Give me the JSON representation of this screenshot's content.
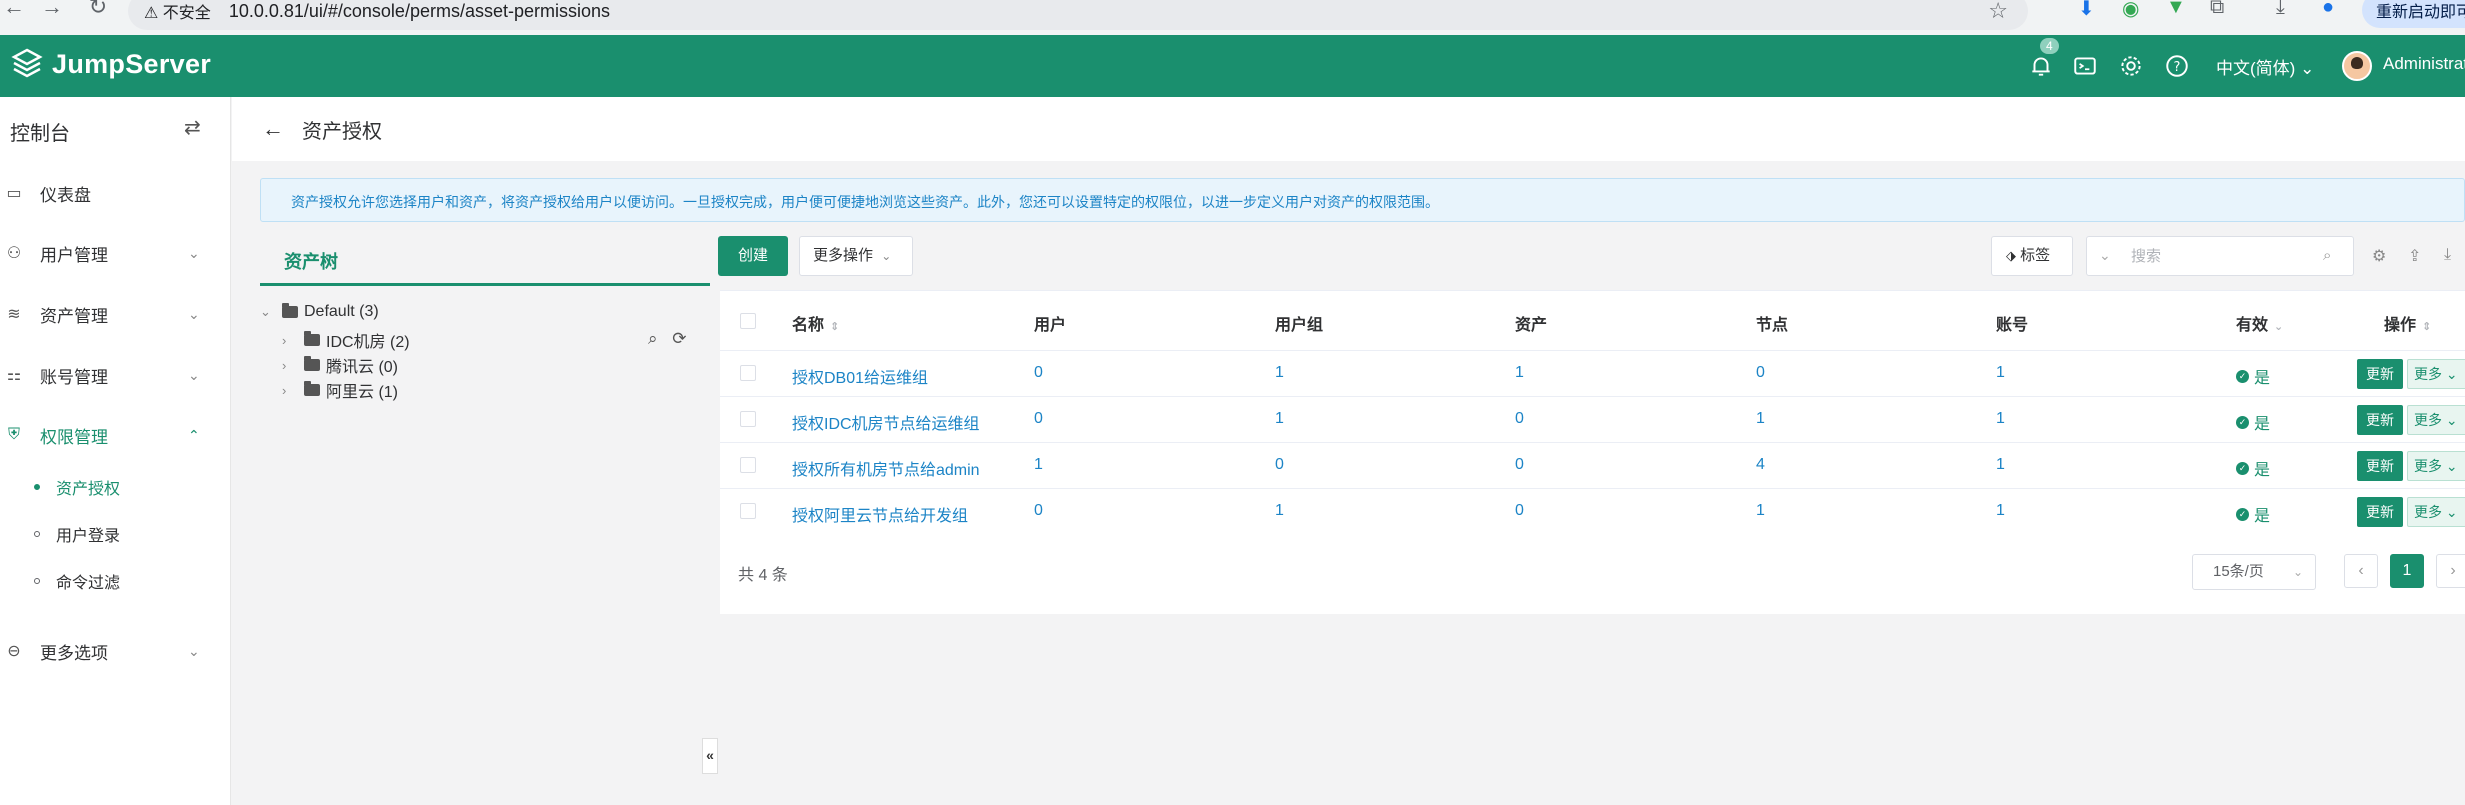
{
  "browser": {
    "security_label": "不安全",
    "url": "10.0.0.81/ui/#/console/perms/asset-permissions",
    "restart_label": "重新启动即可"
  },
  "header": {
    "app_name": "JumpServer",
    "notification_count": "4",
    "language": "中文(简体)",
    "user_name": "Administrator",
    "brand_color": "#1a8f6e"
  },
  "sidebar": {
    "title": "控制台",
    "items": [
      {
        "label": "仪表盘",
        "icon": "dashboard-icon"
      },
      {
        "label": "用户管理",
        "icon": "users-icon"
      },
      {
        "label": "资产管理",
        "icon": "assets-icon"
      },
      {
        "label": "账号管理",
        "icon": "accounts-icon"
      },
      {
        "label": "权限管理",
        "icon": "shield-icon"
      },
      {
        "label": "更多选项",
        "icon": "more-options-icon"
      }
    ],
    "perm_sub": [
      "资产授权",
      "用户登录",
      "命令过滤"
    ]
  },
  "page": {
    "title": "资产授权",
    "banner": "资产授权允许您选择用户和资产，将资产授权给用户以便访问。一旦授权完成，用户便可便捷地浏览这些资产。此外，您还可以设置特定的权限位，以进一步定义用户对资产的权限范围。"
  },
  "tree": {
    "tab": "资产树",
    "nodes": [
      "Default (3)",
      "IDC机房 (2)",
      "腾讯云 (0)",
      "阿里云 (1)"
    ]
  },
  "toolbar": {
    "create": "创建",
    "more_ops": "更多操作",
    "tags": "标签",
    "search_placeholder": "搜索"
  },
  "table": {
    "columns": [
      "名称",
      "用户",
      "用户组",
      "资产",
      "节点",
      "账号",
      "有效",
      "操作"
    ],
    "rows": [
      {
        "name": "授权DB01给运维组",
        "users": "0",
        "groups": "1",
        "assets": "1",
        "nodes": "0",
        "accounts": "1",
        "valid": "是"
      },
      {
        "name": "授权IDC机房节点给运维组",
        "users": "0",
        "groups": "1",
        "assets": "0",
        "nodes": "1",
        "accounts": "1",
        "valid": "是"
      },
      {
        "name": "授权所有机房节点给admin",
        "users": "1",
        "groups": "0",
        "assets": "0",
        "nodes": "4",
        "accounts": "1",
        "valid": "是"
      },
      {
        "name": "授权阿里云节点给开发组",
        "users": "0",
        "groups": "1",
        "assets": "0",
        "nodes": "1",
        "accounts": "1",
        "valid": "是"
      }
    ],
    "update_label": "更新",
    "more_label": "更多"
  },
  "pagination": {
    "total": "共 4 条",
    "page_size": "15条/页",
    "current_page": "1"
  }
}
